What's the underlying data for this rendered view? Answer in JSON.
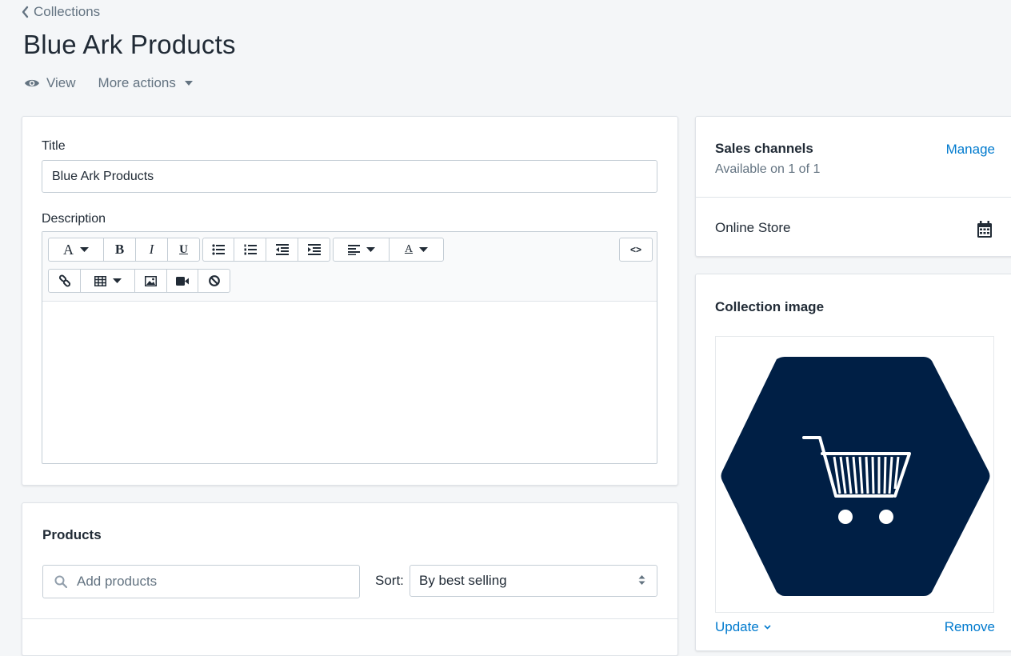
{
  "breadcrumb": {
    "label": "Collections"
  },
  "page": {
    "title": "Blue Ark Products"
  },
  "header_actions": {
    "view": "View",
    "more_actions": "More actions"
  },
  "main_card": {
    "title_label": "Title",
    "title_value": "Blue Ark Products",
    "description_label": "Description"
  },
  "toolbar": {
    "font_glyph": "A",
    "bold_glyph": "B",
    "italic_glyph": "I",
    "underline_glyph": "U",
    "text_color_glyph": "A",
    "code_glyph": "<>"
  },
  "products": {
    "heading": "Products",
    "search_placeholder": "Add products",
    "sort_label": "Sort:",
    "sort_value": "By best selling"
  },
  "sales_channels": {
    "heading": "Sales channels",
    "manage": "Manage",
    "availability": "Available on 1 of 1",
    "channel": "Online Store"
  },
  "collection_image": {
    "heading": "Collection image",
    "update": "Update",
    "remove": "Remove"
  },
  "colors": {
    "link": "#007ace",
    "image_bg": "#001f45"
  }
}
